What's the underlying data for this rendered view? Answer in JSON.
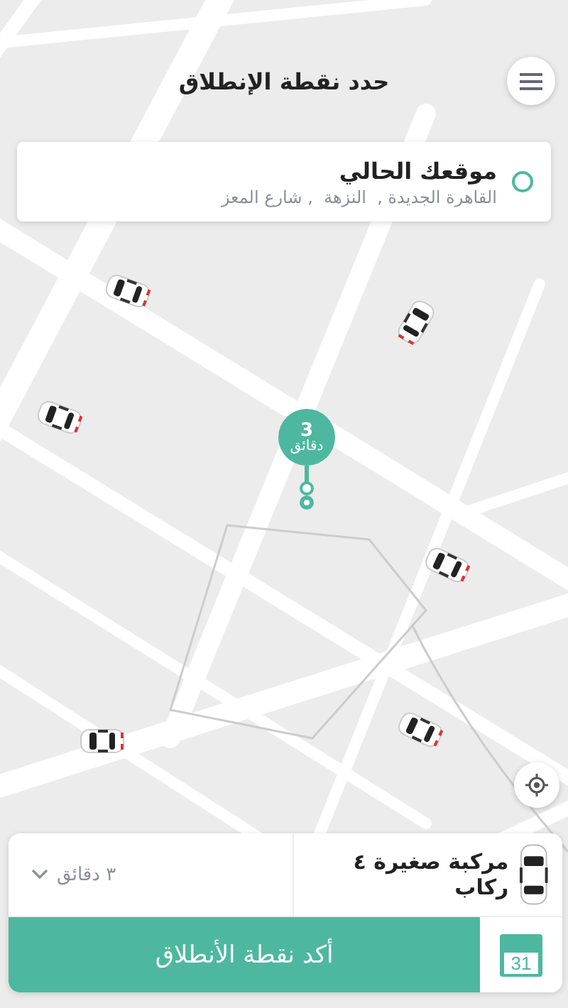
{
  "header": {
    "title": "حدد نقطة الإنطلاق"
  },
  "location": {
    "title": "موقعك الحالي",
    "address": "القاهرة الجديدة ,  النزهة  , شارع المعز"
  },
  "pin": {
    "minutes": "3",
    "unit": "دقائق"
  },
  "vehicle": {
    "name": "مركبة صغيرة ٤ ركاب",
    "eta": "٣ دقائق"
  },
  "confirm_button": {
    "label": "أكد نقطة الأنطلاق"
  },
  "schedule": {
    "day": "31"
  }
}
